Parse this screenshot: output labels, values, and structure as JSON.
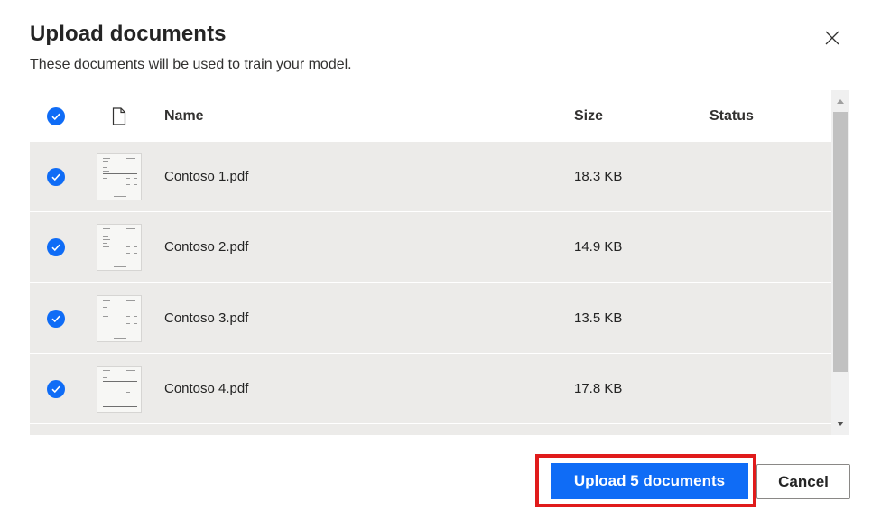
{
  "dialog": {
    "title": "Upload documents",
    "subtitle": "These documents will be used to train your model.",
    "close_icon": "close-icon"
  },
  "table": {
    "columns": {
      "select_all_icon": "check-circle-icon",
      "file_type_icon": "document-icon",
      "name": "Name",
      "size": "Size",
      "status": "Status"
    },
    "rows": [
      {
        "checked": true,
        "name": "Contoso 1.pdf",
        "size": "18.3 KB",
        "status": ""
      },
      {
        "checked": true,
        "name": "Contoso 2.pdf",
        "size": "14.9 KB",
        "status": ""
      },
      {
        "checked": true,
        "name": "Contoso 3.pdf",
        "size": "13.5 KB",
        "status": ""
      },
      {
        "checked": true,
        "name": "Contoso 4.pdf",
        "size": "17.8 KB",
        "status": ""
      }
    ]
  },
  "footer": {
    "upload_label": "Upload 5 documents",
    "cancel_label": "Cancel"
  },
  "colors": {
    "accent": "#0f6cf6",
    "highlight": "#e01b1b",
    "row_bg": "#ecebe9"
  }
}
